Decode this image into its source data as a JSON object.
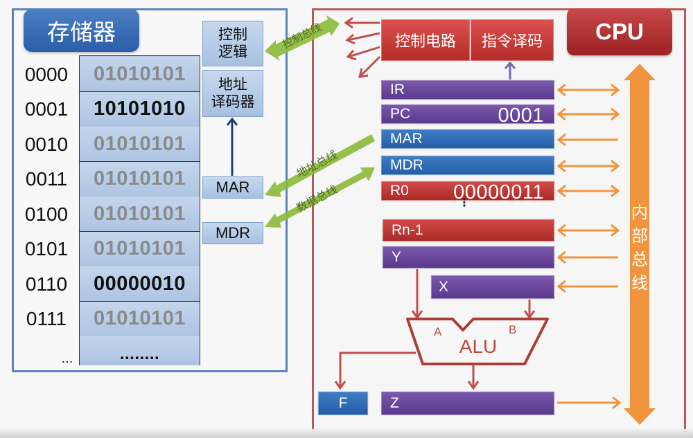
{
  "memory": {
    "title": "存储器",
    "rows": [
      {
        "address": "0000",
        "value": "01010101",
        "highlight": false
      },
      {
        "address": "0001",
        "value": "10101010",
        "highlight": true
      },
      {
        "address": "0010",
        "value": "01010101",
        "highlight": false
      },
      {
        "address": "0011",
        "value": "01010101",
        "highlight": false
      },
      {
        "address": "0100",
        "value": "01010101",
        "highlight": false
      },
      {
        "address": "0101",
        "value": "01010101",
        "highlight": false
      },
      {
        "address": "0110",
        "value": "00000010",
        "highlight": true
      },
      {
        "address": "0111",
        "value": "01010101",
        "highlight": false
      }
    ],
    "ellipsis_address": "…",
    "ellipsis_value": "........",
    "control_logic": "控制\n逻辑",
    "address_decoder": "地址\n译码器",
    "mar": "MAR",
    "mdr": "MDR"
  },
  "buses": {
    "control": "控制总线",
    "address": "地址总线",
    "data": "数据总线",
    "internal": [
      "内",
      "部",
      "总",
      "线"
    ]
  },
  "cpu": {
    "title": "CPU",
    "control_circuit": "控制电路",
    "instruction_decoder": "指令译码",
    "registers": {
      "ir": {
        "label": "IR",
        "value": ""
      },
      "pc": {
        "label": "PC",
        "value": "0001"
      },
      "mar": {
        "label": "MAR",
        "value": ""
      },
      "mdr": {
        "label": "MDR",
        "value": ""
      },
      "r0": {
        "label": "R0",
        "value": "00000011"
      },
      "ellipsis": "⋮",
      "rn1": {
        "label": "Rn-1",
        "value": ""
      },
      "y": {
        "label": "Y",
        "value": ""
      },
      "x": {
        "label": "X",
        "value": ""
      },
      "z": {
        "label": "Z",
        "value": ""
      },
      "f": {
        "label": "F",
        "value": ""
      }
    },
    "alu": {
      "label": "ALU",
      "input_a": "A",
      "input_b": "B"
    }
  },
  "colors": {
    "memory_blue": "#5a85c0",
    "cpu_red": "#b85a5a",
    "bus_orange": "#f0953e",
    "bus_green": "#8cbb3c",
    "register_purple": "#6a4a9c",
    "register_blue": "#3070b8",
    "register_red": "#c03a36"
  }
}
